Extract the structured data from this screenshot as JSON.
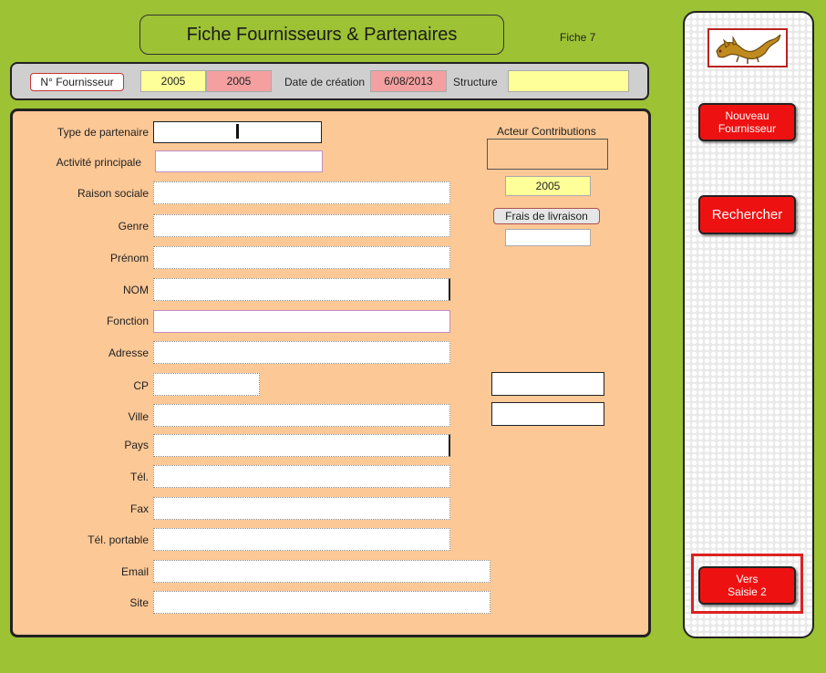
{
  "header": {
    "title": "Fiche Fournisseurs & Partenaires",
    "fiche": "Fiche 7"
  },
  "topbar": {
    "num_label": "N° Fournisseur",
    "num_value": "2005",
    "num_value2": "2005",
    "date_label": "Date de création",
    "date_value": "6/08/2013",
    "structure_label": "Structure",
    "structure_value": ""
  },
  "form": {
    "type_partenaire": "Type de partenaire",
    "activite": "Activité principale",
    "raison_sociale": "Raison sociale",
    "genre": "Genre",
    "prenom": "Prénom",
    "nom": "NOM",
    "fonction": "Fonction",
    "adresse": "Adresse",
    "cp": "CP",
    "ville": "Ville",
    "pays": "Pays",
    "tel": "Tél.",
    "fax": "Fax",
    "tel_portable": "Tél. portable",
    "email": "Email",
    "site": "Site"
  },
  "side": {
    "acteur_label": "Acteur Contributions",
    "year": "2005",
    "frais_label": "Frais de livraison"
  },
  "nav": {
    "nouveau_line1": "Nouveau",
    "nouveau_line2": "Fournisseur",
    "rechercher": "Rechercher",
    "vers_line1": "Vers",
    "vers_line2": "Saisie 2"
  },
  "colors": {
    "background": "#9dc234",
    "panel": "#fcc896",
    "button": "#ee1111"
  }
}
